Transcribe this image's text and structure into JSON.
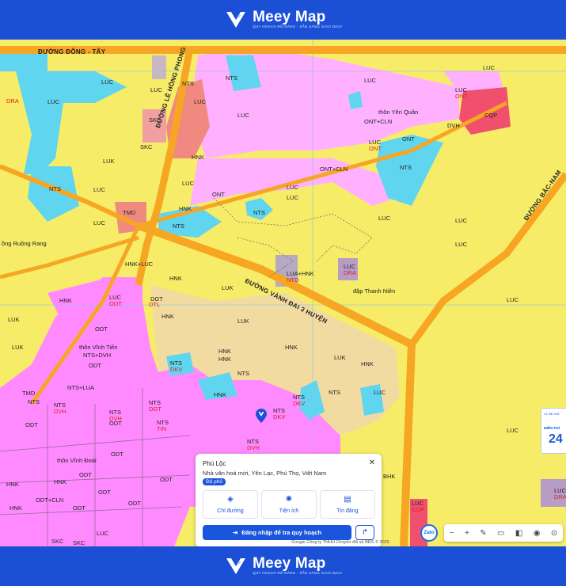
{
  "brand": {
    "name": "Meey Map",
    "tagline": "QUY HOẠCH RÕ RÀNG - SẴN SÀNG GIAO DỊCH"
  },
  "roads": {
    "dong_tay": "ĐƯỜNG ĐÔNG - TÂY",
    "le_hong_phong": "ĐƯỜNG LÊ HỒNG PHONG",
    "vanh_dai": "ĐƯỜNG VÀNH ĐAI 3 HUYỆN",
    "bac_nam": "ĐƯỜNG BẮC-NAM"
  },
  "places": {
    "yen_quan": "thôn Yên Quân",
    "vinh_tien": "thôn Vĩnh Tiến",
    "vinh_doai": "thôn Vĩnh Đoài",
    "dap_thanh_nien": "đập Thanh Niên",
    "ruong_rang": "ồng Ruộng Rang"
  },
  "labels": {
    "luc": "LUC",
    "nts": "NTS",
    "hnk": "HNK",
    "odt": "ODT",
    "ont": "ONT",
    "luk": "LUK",
    "skc": "SKC",
    "tmd": "TMD",
    "dvh": "DVH",
    "dtl": "DTL",
    "dkv": "DKV",
    "dgt": "DGT",
    "cqp": "CQP",
    "ntd": "NTD",
    "ont_cln": "ONT+CLN",
    "hnk_luc": "HNK+LUC",
    "lua_hnk": "LUA+HNK",
    "nts_dvh": "NTS+DVH",
    "nts_lua": "NTS+LUA",
    "odt_cln": "ODT+CLN",
    "dra": "DRA",
    "bhk": "BHK",
    "tin": "TIN"
  },
  "popup": {
    "title": "Phú Lộc",
    "address": "Nhà văn hoá mới, Yên Lạc, Phú Thọ, Việt Nam",
    "badge": "Độ phủ",
    "actions": [
      {
        "label": "Chỉ đường",
        "icon": "directions-icon"
      },
      {
        "label": "Tiện ích",
        "icon": "amenities-icon"
      },
      {
        "label": "Tin đăng",
        "icon": "listing-icon"
      }
    ],
    "login": "Đăng nhập để tra quy hoạch",
    "close": "✕"
  },
  "side_panel": {
    "line1": "CL BĐ GIÁ",
    "line2": "MIỀN PHÍ",
    "value": "24"
  },
  "controls": {
    "zalo": "Zalo",
    "zoom_out": "−",
    "zoom_in": "+"
  },
  "credit": "Google  Công ty TNHH Chuyển đổi số BĐS © 2025",
  "colors": {
    "agri": "#f7ec67",
    "aqua": "#5fd5f0",
    "urban": "#ff8aff",
    "rural": "#ffb1ff",
    "road": "#f6a623",
    "defense": "#f0506e",
    "perennial": "#f2dba0",
    "brand": "#1a56db"
  }
}
